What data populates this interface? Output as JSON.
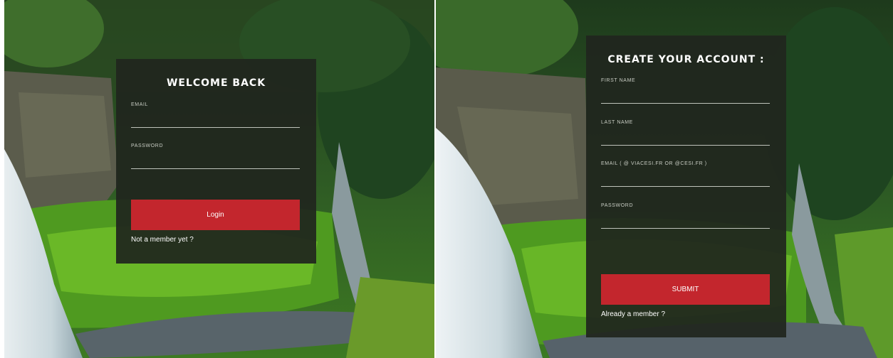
{
  "login": {
    "title": "WELCOME BACK",
    "fields": [
      {
        "label": "EMAIL",
        "value": ""
      },
      {
        "label": "PASSWORD",
        "value": ""
      }
    ],
    "submit_label": "Login",
    "footer_link": "Not a member yet ?"
  },
  "signup": {
    "title": "CREATE YOUR ACCOUNT :",
    "fields": [
      {
        "label": "FIRST NAME",
        "value": ""
      },
      {
        "label": "LAST NAME",
        "value": ""
      },
      {
        "label": "EMAIL ( @ VIACESI.FR OR @CESI.FR )",
        "value": ""
      },
      {
        "label": "PASSWORD",
        "value": ""
      }
    ],
    "submit_label": "SUBMIT",
    "footer_link": "Already a member ?"
  },
  "colors": {
    "accent_button": "#c3262d",
    "card_background": "#20261e"
  }
}
